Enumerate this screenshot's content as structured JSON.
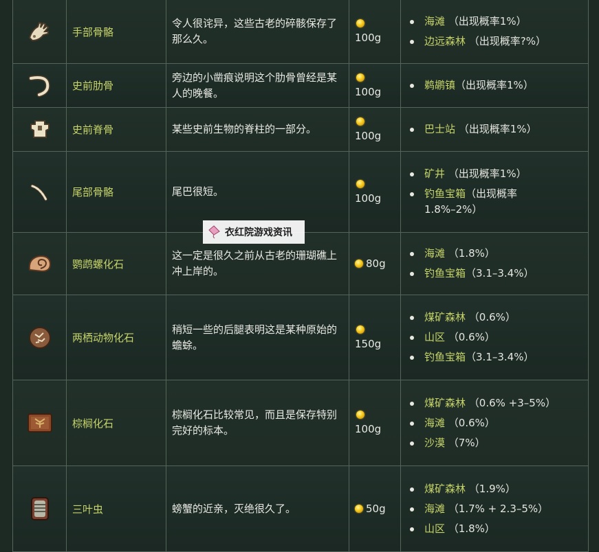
{
  "rows": [
    {
      "icon": "hand-bones-icon",
      "name": "手部骨骼",
      "description": "令人很诧异，这些古老的碎骸保存了那么久。",
      "price": "100g",
      "locations": [
        {
          "place": "海滩",
          "rate": "（出现概率1%）"
        },
        {
          "place": "边远森林",
          "rate": "（出现概率?%）"
        }
      ]
    },
    {
      "icon": "rib-bone-icon",
      "name": "史前肋骨",
      "description": "旁边的小凿痕说明这个肋骨曾经是某人的晚餐。",
      "price": "100g",
      "locations": [
        {
          "place": "鹈鹕镇",
          "rate": "（出现概率1%）"
        }
      ]
    },
    {
      "icon": "vertebra-icon",
      "name": "史前脊骨",
      "description": "某些史前生物的脊柱的一部分。",
      "price": "100g",
      "locations": [
        {
          "place": "巴士站",
          "rate": "（出现概率1%）"
        }
      ]
    },
    {
      "icon": "tail-bone-icon",
      "name": "尾部骨骼",
      "description": "尾巴很短。",
      "price": "100g",
      "locations": [
        {
          "place": "矿井",
          "rate": "（出现概率1%）"
        },
        {
          "place": "钓鱼宝箱",
          "rate": "（出现概率1.8%–2%）"
        }
      ]
    },
    {
      "icon": "nautilus-fossil-icon",
      "name": "鹦鹉螺化石",
      "description": "这一定是很久之前从古老的珊瑚礁上冲上岸的。",
      "price": "80g",
      "locations": [
        {
          "place": "海滩",
          "rate": "（1.8%）"
        },
        {
          "place": "钓鱼宝箱",
          "rate": "（3.1–3.4%）"
        }
      ]
    },
    {
      "icon": "amphibian-fossil-icon",
      "name": "两栖动物化石",
      "description": "稍短一些的后腿表明这是某种原始的蟾蜍。",
      "price": "150g",
      "locations": [
        {
          "place": "煤矿森林",
          "rate": "（0.6%）"
        },
        {
          "place": "山区",
          "rate": "（0.6%）"
        },
        {
          "place": "钓鱼宝箱",
          "rate": "（3.1–3.4%）"
        }
      ]
    },
    {
      "icon": "palm-fossil-icon",
      "name": "棕榈化石",
      "description": "棕榈化石比较常见，而且是保存特别完好的标本。",
      "price": "100g",
      "locations": [
        {
          "place": "煤矿森林",
          "rate": "（0.6% +3–5%）"
        },
        {
          "place": "海滩",
          "rate": "（0.6%）"
        },
        {
          "place": "沙漠",
          "rate": "（7%）"
        }
      ]
    },
    {
      "icon": "trilobite-icon",
      "name": "三叶虫",
      "description": "螃蟹的近亲，灭绝很久了。",
      "price": "50g",
      "locations": [
        {
          "place": "煤矿森林",
          "rate": "（1.9%）"
        },
        {
          "place": "海滩",
          "rate": "（1.7% + 2.3–5%）"
        },
        {
          "place": "山区",
          "rate": "（1.8%）"
        }
      ]
    }
  ],
  "watermark": {
    "text": "衣红院游戏资讯",
    "icon": "kite-icon"
  }
}
